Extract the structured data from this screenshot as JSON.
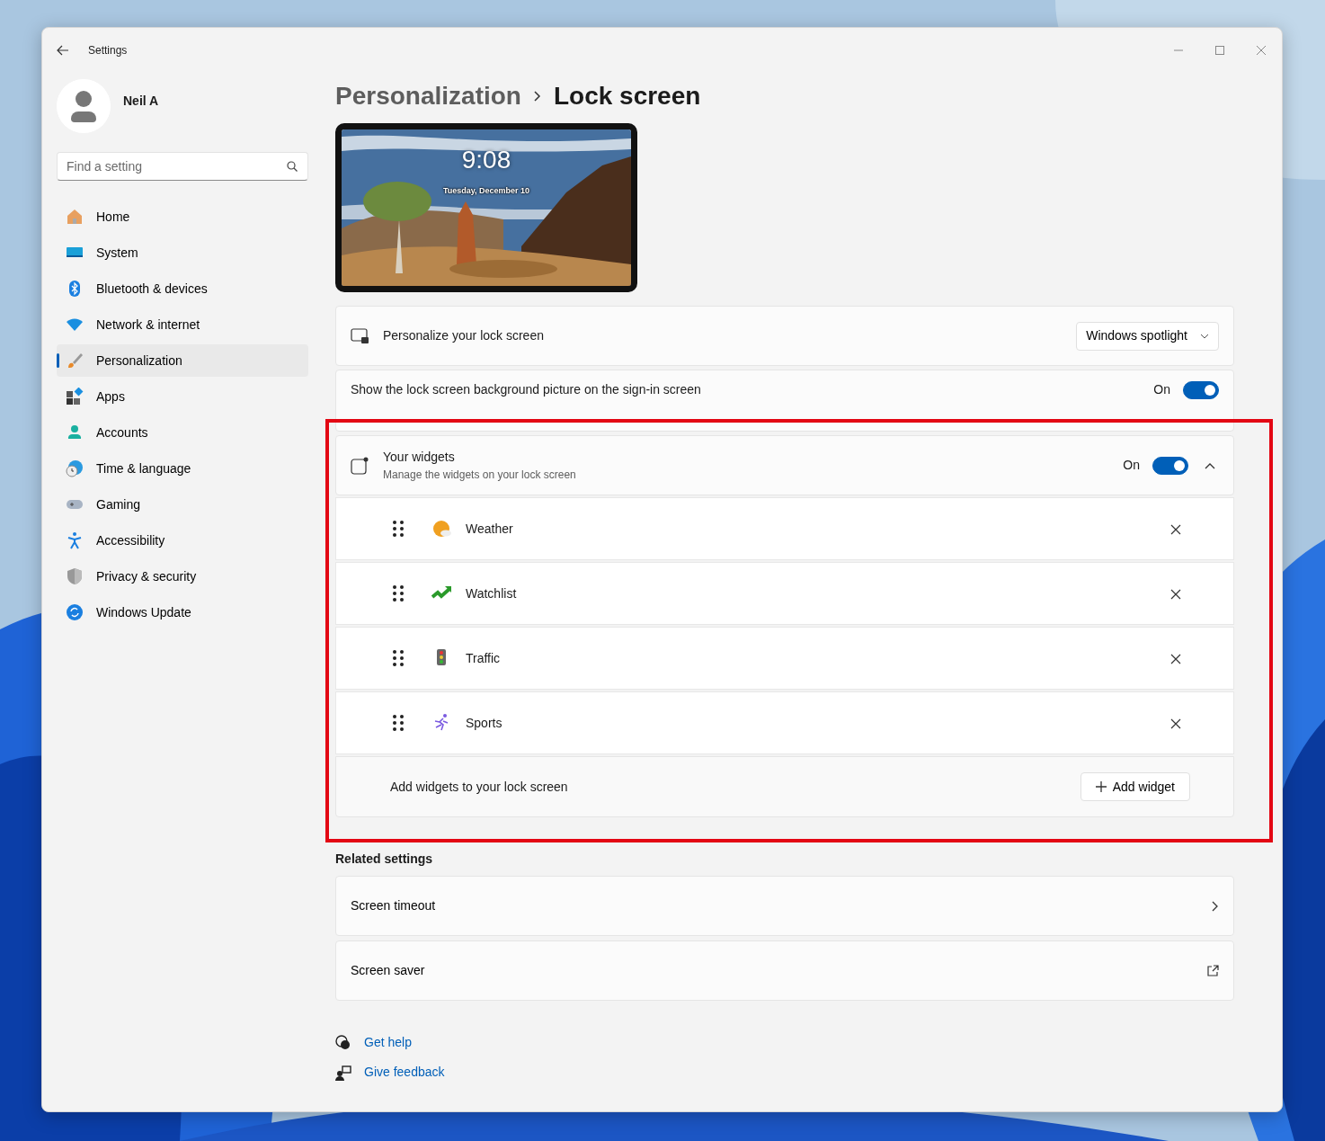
{
  "window": {
    "title": "Settings"
  },
  "user": {
    "name": "Neil A"
  },
  "search": {
    "placeholder": "Find a setting"
  },
  "sidebar": {
    "items": [
      {
        "label": "Home",
        "selected": false
      },
      {
        "label": "System",
        "selected": false
      },
      {
        "label": "Bluetooth & devices",
        "selected": false
      },
      {
        "label": "Network & internet",
        "selected": false
      },
      {
        "label": "Personalization",
        "selected": true
      },
      {
        "label": "Apps",
        "selected": false
      },
      {
        "label": "Accounts",
        "selected": false
      },
      {
        "label": "Time & language",
        "selected": false
      },
      {
        "label": "Gaming",
        "selected": false
      },
      {
        "label": "Accessibility",
        "selected": false
      },
      {
        "label": "Privacy & security",
        "selected": false
      },
      {
        "label": "Windows Update",
        "selected": false
      }
    ]
  },
  "breadcrumb": {
    "parent": "Personalization",
    "current": "Lock screen"
  },
  "preview": {
    "time": "9:08",
    "date": "Tuesday, December 10"
  },
  "settings": [
    {
      "kind": "dropdown",
      "label": "Personalize your lock screen",
      "value": "Windows spotlight"
    },
    {
      "kind": "toggle",
      "label": "Show the lock screen background picture on the sign-in screen",
      "state_label": "On",
      "on": true
    }
  ],
  "widgets": {
    "title": "Your widgets",
    "subtitle": "Manage the widgets on your lock screen",
    "state_label": "On",
    "on": true,
    "expanded": true,
    "items": [
      {
        "label": "Weather"
      },
      {
        "label": "Watchlist"
      },
      {
        "label": "Traffic"
      },
      {
        "label": "Sports"
      }
    ],
    "add_text": "Add widgets to your lock screen",
    "add_button": "Add widget"
  },
  "related": {
    "heading": "Related settings",
    "items": [
      {
        "label": "Screen timeout",
        "kind": "chevron"
      },
      {
        "label": "Screen saver",
        "kind": "external"
      }
    ]
  },
  "help_links": [
    {
      "label": "Get help"
    },
    {
      "label": "Give feedback"
    }
  ],
  "highlight": {
    "color": "#e30613"
  }
}
